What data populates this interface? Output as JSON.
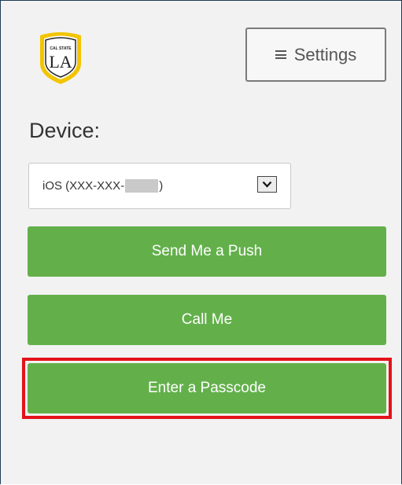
{
  "logo": {
    "small_text": "CAL STATE",
    "big_text": "LA",
    "icon": "cal-state-la-shield-logo"
  },
  "settings": {
    "label": "Settings",
    "icon": "hamburger-menu-icon"
  },
  "device": {
    "label": "Device:",
    "selected_prefix": "iOS (XXX-XXX-",
    "selected_suffix": ")",
    "dropdown_icon": "chevron-down-icon"
  },
  "actions": {
    "push_label": "Send Me a Push",
    "call_label": "Call Me",
    "passcode_label": "Enter a Passcode"
  },
  "colors": {
    "button_green": "#63b04b",
    "highlight_red": "#e3121a",
    "logo_gold": "#f2c500"
  }
}
